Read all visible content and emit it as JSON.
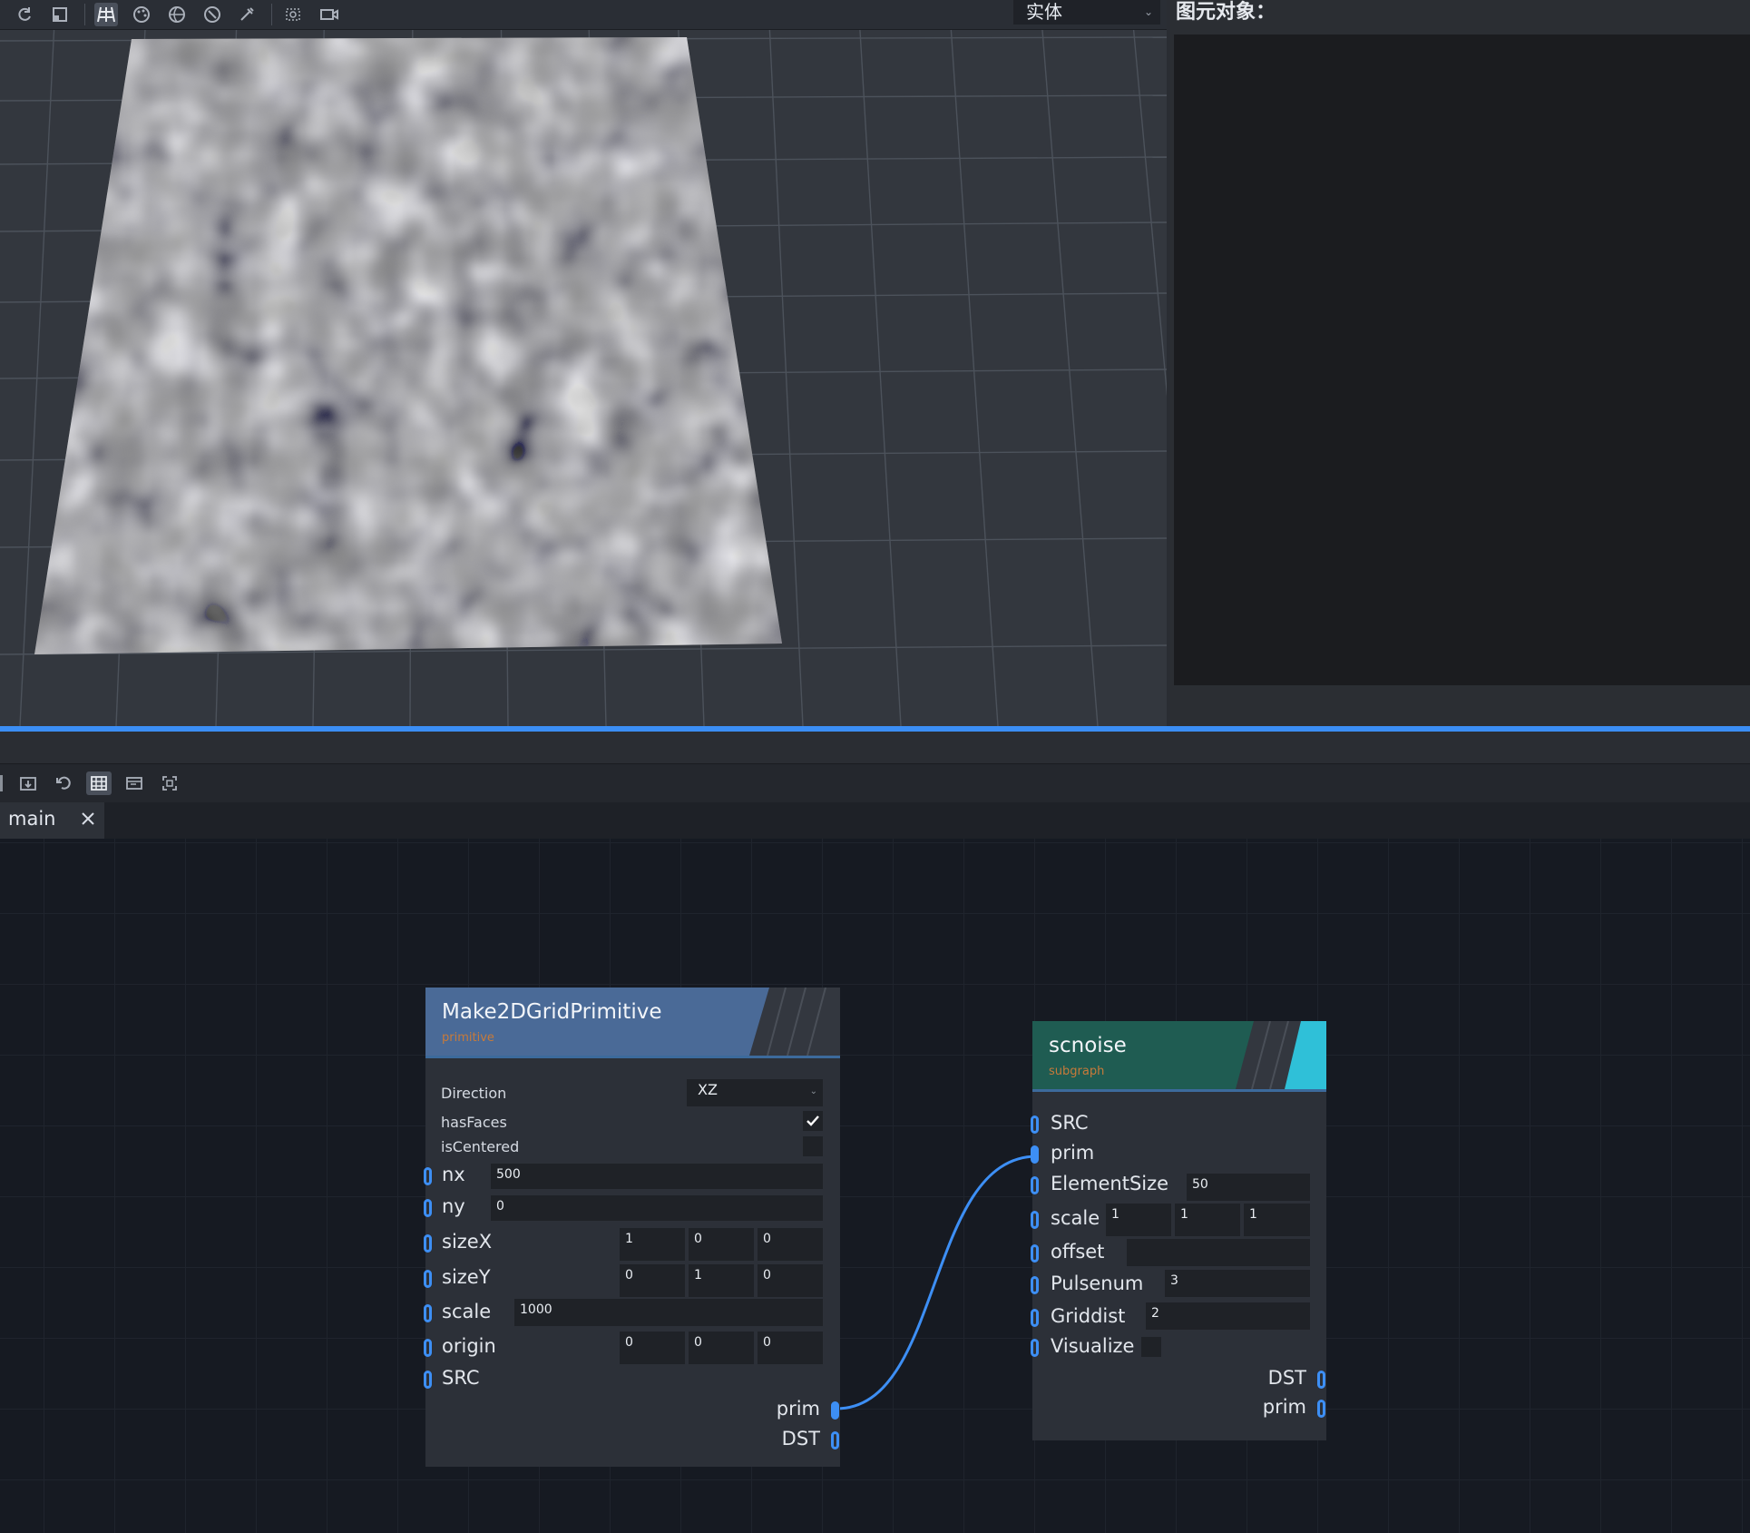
{
  "toolbar": {
    "display_mode": "实体"
  },
  "right_panel": {
    "title": "图元对象："
  },
  "editor": {
    "tab_label": "main"
  },
  "nodes": {
    "make_grid": {
      "title": "Make2DGridPrimitive",
      "category": "primitive",
      "direction_label": "Direction",
      "direction_value": "XZ",
      "hasfaces_label": "hasFaces",
      "hasfaces_checked": true,
      "iscentered_label": "isCentered",
      "iscentered_checked": false,
      "nx_label": "nx",
      "nx_value": "500",
      "ny_label": "ny",
      "ny_value": "0",
      "sizex_label": "sizeX",
      "sizex_values": [
        "1",
        "0",
        "0"
      ],
      "sizey_label": "sizeY",
      "sizey_values": [
        "0",
        "1",
        "0"
      ],
      "scale_label": "scale",
      "scale_value": "1000",
      "origin_label": "origin",
      "origin_values": [
        "0",
        "0",
        "0"
      ],
      "src_label": "SRC",
      "out_prim": "prim",
      "out_dst": "DST"
    },
    "scnoise": {
      "title": "scnoise",
      "category": "subgraph",
      "src_label": "SRC",
      "prim_label": "prim",
      "elementsize_label": "ElementSize",
      "elementsize_value": "50",
      "scale_label": "scale",
      "scale_values": [
        "1",
        "1",
        "1"
      ],
      "offset_label": "offset",
      "offset_value": "",
      "pulsenum_label": "Pulsenum",
      "pulsenum_value": "3",
      "griddist_label": "Griddist",
      "griddist_value": "2",
      "visualize_label": "Visualize",
      "visualize_checked": false,
      "out_dst": "DST",
      "out_prim": "prim"
    }
  },
  "colors": {
    "accent": "#3b8ef5",
    "make_grid_header": "#4a6a97",
    "scnoise_header": "#1f5c52",
    "scnoise_stripe": "#2fc0d8",
    "category_text": "#c77a3a"
  }
}
